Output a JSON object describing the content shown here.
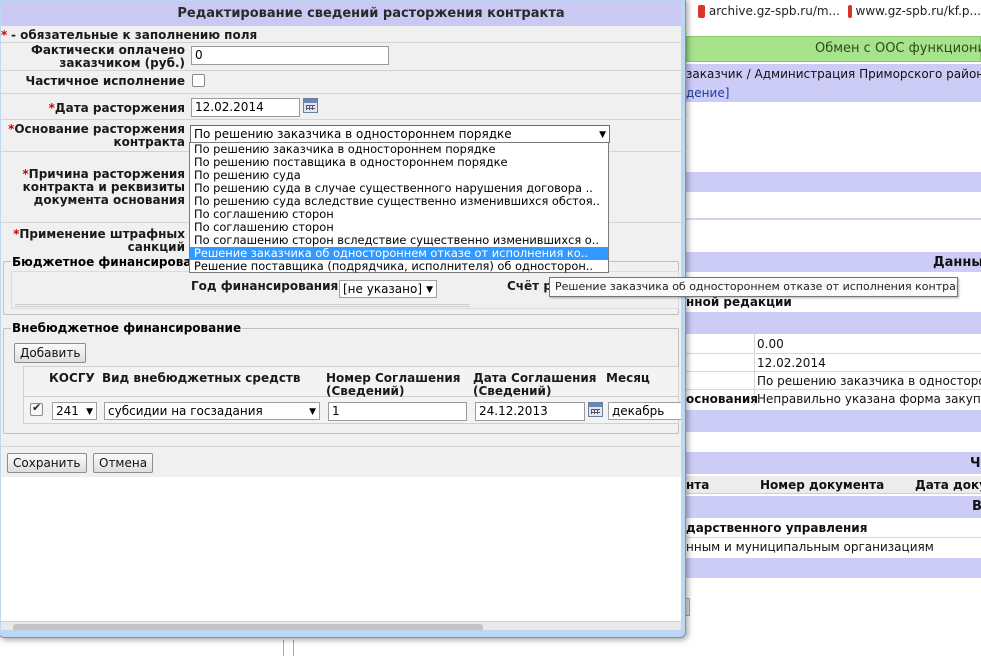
{
  "background": {
    "tabs": [
      {
        "label": "archive.gz-spb.ru/m..."
      },
      {
        "label": "www.gz-spb.ru/kf.p..."
      }
    ],
    "oos_banner": "Обмен с ООС функциони",
    "customer_line": "заказчик / Администрация Приморского района С",
    "link_line": "дение]",
    "section_data": "Данны",
    "edition_label": "нной редакции",
    "values": {
      "paid": "0.00",
      "date": "12.02.2014",
      "basis": "По решению заказчика в односторонн",
      "reason_label": "основания",
      "reason_value": "Неправильно указана форма закупки"
    },
    "section_c": "Ч",
    "table_headers": [
      "нта",
      "Номер документа",
      "Дата доку"
    ],
    "section_v": "В",
    "gov_mgmt": "дарственного управления",
    "municipal": "нным и муниципальным организациям"
  },
  "dialog": {
    "title": "Редактирование сведений расторжения контракта",
    "required_note": "- обязательные к заполнению поля",
    "required_star": "*",
    "paid_label_1": "Фактически оплачено",
    "paid_label_2": "заказчиком (руб.)",
    "paid_value": "0",
    "partial_label": "Частичное исполнение",
    "date_label": "Дата расторжения",
    "date_value": "12.02.2014",
    "basis_label_1": "Основание расторжения",
    "basis_label_2": "контракта",
    "basis_selected": "По решению заказчика в одностороннем порядке",
    "basis_options": [
      "По решению заказчика в одностороннем порядке",
      "По решению поставщика в одностороннем порядке",
      "По решению суда",
      "По решению суда в случае существенного нарушения договора ..",
      "По решению суда вследствие существенно изменившихся обстоя..",
      "По соглашению сторон",
      "По соглашению сторон",
      "По соглашению сторон вследствие существенно изменившихся о..",
      "Решение заказчика об одностороннем отказе от исполнения ко..",
      "Решение поставщика (подрядчика, исполнителя) об односторон.."
    ],
    "highlighted_option_index": 8,
    "tooltip": "Решение заказчика об одностороннем отказе от исполнения контракта",
    "reason_label_1": "Причина расторжения",
    "reason_label_2": "контракта и реквизиты",
    "reason_label_3": "документа основания",
    "penalty_label_1": "Применение штрафных",
    "penalty_label_2": "санкций",
    "budget_legend": "Бюджетное финансирован",
    "year_label": "Год финансирования",
    "year_value": "[не указано]",
    "account_label": "Счёт р",
    "extra_legend": "Внебюджетное финансирование",
    "add_button": "Добавить",
    "table": {
      "headers": {
        "kosgu": "КОСГУ",
        "kind": "Вид внебюджетных средств",
        "num_1": "Номер Соглашения",
        "num_2": "(Сведений)",
        "date_1": "Дата Соглашения",
        "date_2": "(Сведений)",
        "month": "Месяц"
      },
      "row": {
        "kosgu": "241",
        "kind": "субсидии на госзадания",
        "number": "1",
        "date": "24.12.2013",
        "month": "декабрь"
      }
    },
    "save_button": "Сохранить",
    "cancel_button": "Отмена"
  }
}
